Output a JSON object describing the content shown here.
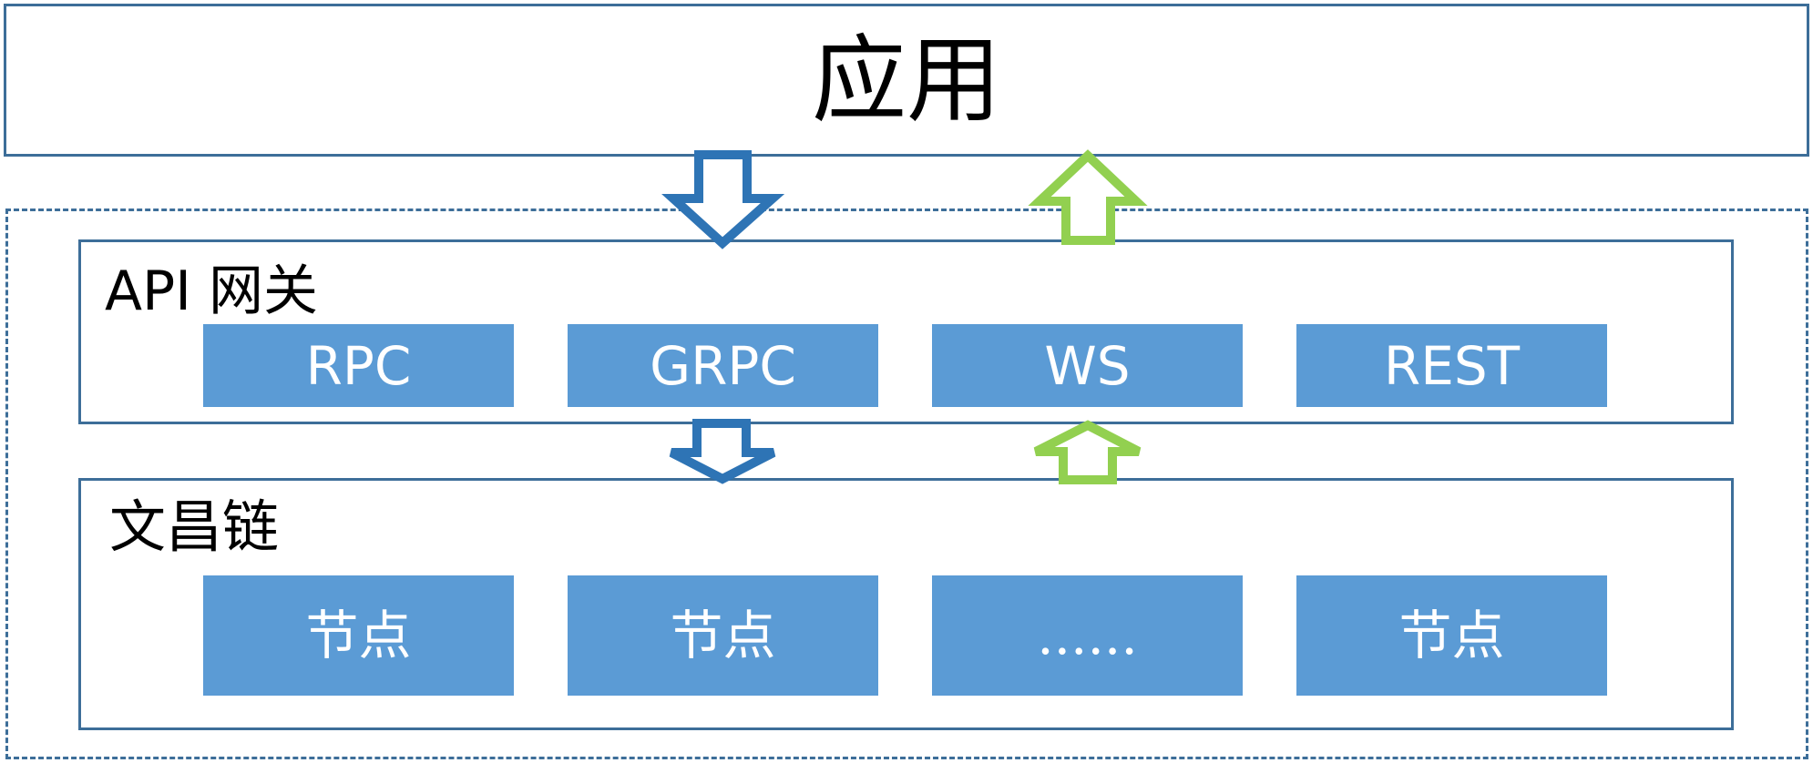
{
  "app": {
    "title": "应用"
  },
  "gateway": {
    "title": "API 网关",
    "protocols": [
      "RPC",
      "GRPC",
      "WS",
      "REST"
    ]
  },
  "chain": {
    "title": "文昌链",
    "nodes": [
      "节点",
      "节点",
      "......",
      "节点"
    ]
  },
  "colors": {
    "border": "#3d6e99",
    "item_fill": "#5b9bd5",
    "down_arrow": "#2e74b5",
    "up_arrow": "#92d050"
  }
}
